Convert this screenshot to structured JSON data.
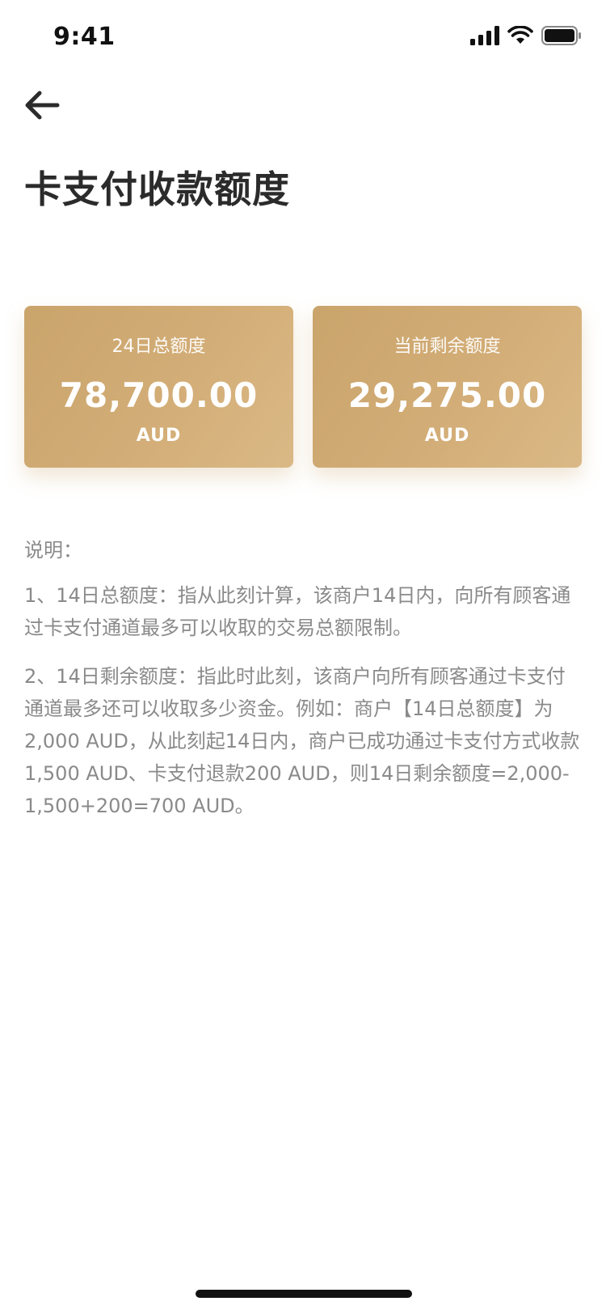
{
  "status_bar": {
    "time": "9:41"
  },
  "nav": {
    "back_icon": "arrow-left-icon"
  },
  "page": {
    "title": "卡支付收款额度"
  },
  "cards": [
    {
      "label": "24日总额度",
      "amount": "78,700.00",
      "currency": "AUD"
    },
    {
      "label": "当前剩余额度",
      "amount": "29,275.00",
      "currency": "AUD"
    }
  ],
  "notes": {
    "heading": "说明：",
    "items": [
      "1、14日总额度：指从此刻计算，该商户14日内，向所有顾客通过卡支付通道最多可以收取的交易总额限制。",
      "2、14日剩余额度：指此时此刻，该商户向所有顾客通过卡支付通道最多还可以收取多少资金。例如：商户【14日总额度】为2,000 AUD，从此刻起14日内，商户已成功通过卡支付方式收款1,500 AUD、卡支付退款200 AUD，则14日剩余额度=2,000-1,500+200=700 AUD。"
    ]
  },
  "colors": {
    "card_gradient_start": "#c9a46b",
    "card_gradient_end": "#dab986",
    "title_text": "#2b2b2b",
    "note_text": "#8a8a8a"
  }
}
